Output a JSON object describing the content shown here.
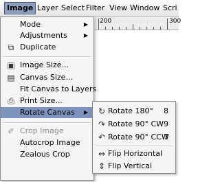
{
  "menubar": {
    "items": [
      "Image",
      "Layer",
      "Select",
      "Filter",
      "View",
      "Window",
      "Scri"
    ]
  },
  "ruler": {
    "label": "200",
    "label2": "300"
  },
  "image_menu": {
    "items": [
      {
        "label": "Mode",
        "icon": "none",
        "submenu": true
      },
      {
        "label": "Adjustments",
        "icon": "none",
        "submenu": true
      },
      {
        "label": "Duplicate",
        "icon": "duplicate-icon"
      },
      {
        "label": "Image Size...",
        "icon": "image-size-icon"
      },
      {
        "label": "Canvas Size...",
        "icon": "canvas-size-icon"
      },
      {
        "label": "Fit Canvas to Layers",
        "icon": "none"
      },
      {
        "label": "Print Size...",
        "icon": "print-size-icon"
      },
      {
        "label": "Rotate Canvas",
        "icon": "none",
        "submenu": true,
        "highlighted": true
      },
      {
        "label": "Crop Image",
        "icon": "crop-icon",
        "disabled": true
      },
      {
        "label": "Autocrop Image",
        "icon": "none"
      },
      {
        "label": "Zealous Crop",
        "icon": "none"
      }
    ]
  },
  "rotate_submenu": {
    "items": [
      {
        "label": "Rotate 180°",
        "shortcut": "8",
        "icon": "rotate-180-icon"
      },
      {
        "label": "Rotate 90° CW",
        "shortcut": "9",
        "icon": "rotate-cw-icon"
      },
      {
        "label": "Rotate 90° CCW",
        "shortcut": "7",
        "icon": "rotate-ccw-icon"
      },
      {
        "label": "Flip Horizontal",
        "shortcut": "",
        "icon": "flip-horizontal-icon"
      },
      {
        "label": "Flip Vertical",
        "shortcut": "",
        "icon": "flip-vertical-icon"
      }
    ]
  },
  "colors": {
    "highlight": "#7d93bd",
    "active_menu": "#8f9fbd"
  }
}
